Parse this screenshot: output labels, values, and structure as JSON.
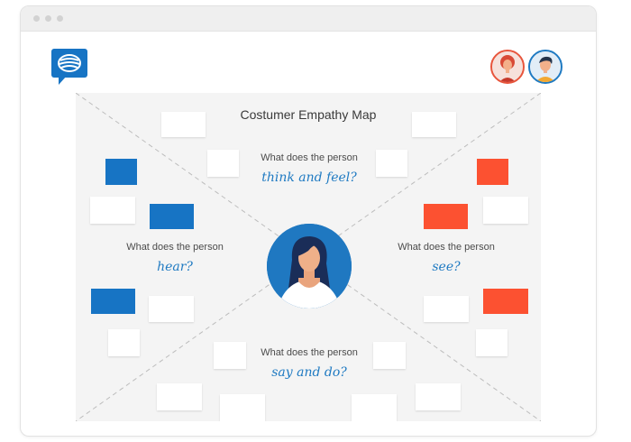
{
  "window": {
    "controls": [
      "close",
      "minimize",
      "maximize"
    ]
  },
  "app": {
    "logo": "chat-bubble-logo-icon"
  },
  "users": [
    {
      "name": "collaborator-1",
      "icon": "woman-avatar-icon",
      "ring": "#e8553c"
    },
    {
      "name": "collaborator-2",
      "icon": "man-avatar-icon",
      "ring": "#1f7ac2"
    }
  ],
  "map": {
    "title": "Costumer Empathy Map",
    "quadrants": {
      "top": {
        "question": "What does the person",
        "highlight": "think and feel?"
      },
      "left": {
        "question": "What does the person",
        "highlight": "hear?"
      },
      "right": {
        "question": "What does the person",
        "highlight": "see?"
      },
      "bottom": {
        "question": "What does the person",
        "highlight": "say and do?"
      }
    },
    "center_icon": "persona-woman-icon"
  },
  "colors": {
    "accent_blue": "#1774c4",
    "accent_red": "#fc5131",
    "highlight_blue": "#1f7ac2",
    "board_bg": "#f4f4f4"
  }
}
